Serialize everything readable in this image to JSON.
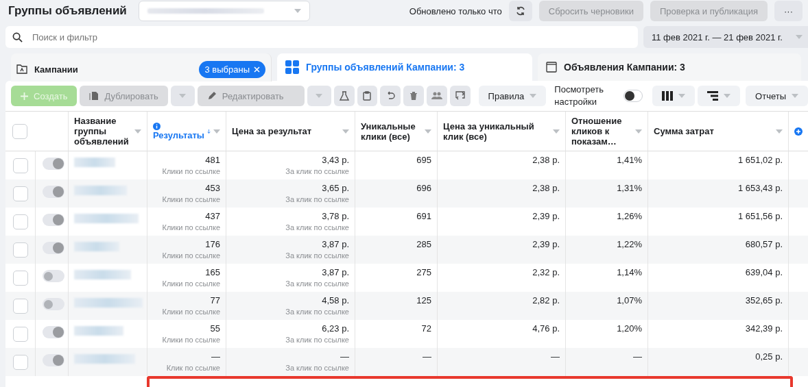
{
  "header": {
    "title": "Группы объявлений",
    "status": "Обновлено только что",
    "buttons": [
      {
        "label": "Сбросить черновики",
        "disabled": true
      },
      {
        "label": "Проверка и публикация",
        "disabled": true
      }
    ],
    "more": "···"
  },
  "search": {
    "placeholder": "Поиск и фильтр"
  },
  "date_range": "11 фев 2021 г. — 21 фев 2021 г.",
  "tabs": [
    {
      "kind": "campaigns",
      "label": "Кампании",
      "selected": false,
      "badge": "3 выбраны"
    },
    {
      "kind": "adsets",
      "label": "Группы объявлений Кампании: 3",
      "selected": true
    },
    {
      "kind": "ads",
      "label": "Объявления Кампании: 3",
      "selected": false
    }
  ],
  "toolbar": {
    "create": "Создать",
    "duplicate": "Дублировать",
    "edit": "Редактировать",
    "rules": "Правила",
    "view_settings": {
      "label": "Посмотреть настройки",
      "on": false
    },
    "reports": "Отчеты"
  },
  "table": {
    "select_all_checked": false,
    "columns": [
      {
        "label": "Название группы объявлений",
        "sorted": false
      },
      {
        "label": "Результаты",
        "sorted": true
      },
      {
        "label": "Цена за результат",
        "sorted": false
      },
      {
        "label": "Уникальные клики (все)",
        "sorted": false
      },
      {
        "label": "Цена за уникальный клик (все)",
        "sorted": false
      },
      {
        "label": "Отношение кликов к показам…",
        "sorted": false
      },
      {
        "label": "Сумма затрат",
        "sorted": false
      }
    ],
    "rows": [
      {
        "checked": false,
        "on": true,
        "results": "481",
        "results_note": "Клики по ссылке",
        "cost": "3,43 р.",
        "cost_note": "За клик по ссылке",
        "unique": "695",
        "unique_cost": "2,38 р.",
        "ctr": "1,41%",
        "spend": "1 651,02 р."
      },
      {
        "checked": false,
        "on": true,
        "results": "453",
        "results_note": "Клики по ссылке",
        "cost": "3,65 р.",
        "cost_note": "За клик по ссылке",
        "unique": "696",
        "unique_cost": "2,38 р.",
        "ctr": "1,31%",
        "spend": "1 653,43 р."
      },
      {
        "checked": false,
        "on": true,
        "results": "437",
        "results_note": "Клики по ссылке",
        "cost": "3,78 р.",
        "cost_note": "За клик по ссылке",
        "unique": "691",
        "unique_cost": "2,39 р.",
        "ctr": "1,26%",
        "spend": "1 651,56 р."
      },
      {
        "checked": false,
        "on": true,
        "results": "176",
        "results_note": "Клики по ссылке",
        "cost": "3,87 р.",
        "cost_note": "За клик по ссылке",
        "unique": "285",
        "unique_cost": "2,39 р.",
        "ctr": "1,22%",
        "spend": "680,57 р."
      },
      {
        "checked": false,
        "on": false,
        "results": "165",
        "results_note": "Клики по ссылке",
        "cost": "3,87 р.",
        "cost_note": "За клик по ссылке",
        "unique": "275",
        "unique_cost": "2,32 р.",
        "ctr": "1,14%",
        "spend": "639,04 р."
      },
      {
        "checked": false,
        "on": false,
        "results": "77",
        "results_note": "Клики по ссылке",
        "cost": "4,58 р.",
        "cost_note": "За клик по ссылке",
        "unique": "125",
        "unique_cost": "2,82 р.",
        "ctr": "1,07%",
        "spend": "352,65 р."
      },
      {
        "checked": false,
        "on": true,
        "results": "55",
        "results_note": "Клики по ссылке",
        "cost": "6,23 р.",
        "cost_note": "За клик по ссылке",
        "unique": "72",
        "unique_cost": "4,76 р.",
        "ctr": "1,20%",
        "spend": "342,39 р."
      },
      {
        "checked": false,
        "on": true,
        "results": "—",
        "results_note": "Клик по ссылке",
        "cost": "—",
        "cost_note": "За клик по ссылке",
        "unique": "—",
        "unique_cost": "—",
        "ctr": "—",
        "spend": "0,25 р."
      }
    ]
  }
}
